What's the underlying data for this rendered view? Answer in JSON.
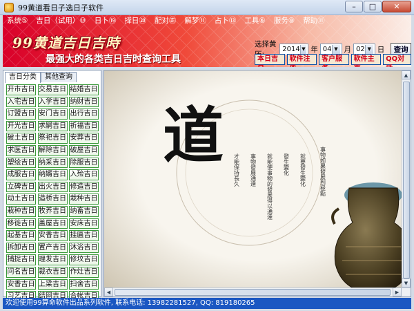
{
  "window": {
    "title": "99黄道看日子选日子软件",
    "min": "–",
    "max": "□",
    "close": "✕"
  },
  "menu": [
    "系统⑤",
    "吉日（试用）⑩",
    "日卜⑲",
    "择日⑳",
    "配对㊣",
    "解梦⑪",
    "占卜⑬",
    "工具⑥",
    "服务⑧",
    "帮助⑪"
  ],
  "header": {
    "logo": "99黄道吉日吉時",
    "slogan": "最强大的各类吉日吉时查询工具",
    "date_label": "选择黄历:",
    "year": "2014",
    "year_unit": "年",
    "month": "04",
    "month_unit": "月",
    "day": "02",
    "day_unit": "日",
    "query": "查询",
    "quick_buttons": [
      "本日吉日",
      "软件注册",
      "客户服务",
      "软件主页",
      "QQ对话"
    ]
  },
  "tabs": [
    "吉日分类",
    "其他查询"
  ],
  "categories": [
    "开市吉日",
    "交易吉日",
    "结婚吉日",
    "入宅吉日",
    "入学吉日",
    "纳财吉日",
    "订盟吉日",
    "安门吉日",
    "出行吉日",
    "开光吉日",
    "求嗣吉日",
    "祈福吉日",
    "破土吉日",
    "祭祀吉日",
    "安葬吉日",
    "求医吉日",
    "解除吉日",
    "破屋吉日",
    "塑绘吉日",
    "纳采吉日",
    "除服吉日",
    "成服吉日",
    "纳婿吉日",
    "入殓吉日",
    "立碑吉日",
    "出火吉日",
    "修造吉日",
    "动土吉日",
    "造桥吉日",
    "栽种吉日",
    "栽种吉日",
    "牧养吉日",
    "纳畜吉日",
    "移徙吉日",
    "盖屋吉日",
    "安床吉日",
    "起基吉日",
    "安香吉日",
    "挂匾吉日",
    "拆卸吉日",
    "置产吉日",
    "沐浴吉日",
    "捕捉吉日",
    "理发吉日",
    "修坟吉日",
    "问名吉日",
    "裁衣吉日",
    "作灶吉日",
    "安香吉日",
    "上梁吉日",
    "扫舍吉日",
    "习艺吉日",
    "结网吉日",
    "合帐吉日"
  ],
  "artwork": {
    "calligraphy": "道",
    "poem": [
      "事物如果發展到極點",
      "就要發生變化",
      "發生變化",
      "就能使事物的發展得以通達",
      "事物發展通達",
      "才能保持長久"
    ]
  },
  "status": "欢迎使用99算命软件出品系列软件, 联系电话: 13982281527, QQ: 819180265",
  "colors": {
    "header_red": "#d9002a",
    "status_blue": "#1b57c2",
    "cell_border": "#3a9a3a",
    "quick_text": "#d2001a"
  }
}
